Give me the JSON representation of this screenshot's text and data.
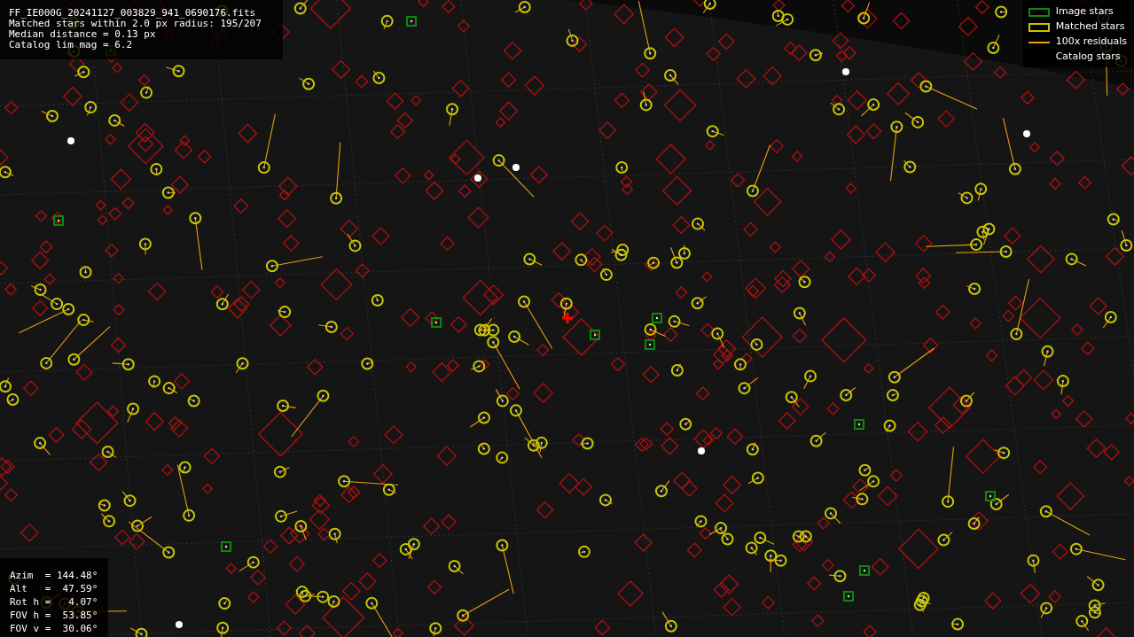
{
  "info_panel": {
    "lines": [
      "FF_IE000G_20241127_003829_941_0690176.fits",
      "Matched stars within 2.0 px radius: 195/207",
      "Median distance = 0.13 px",
      "Catalog lim mag = 6.2"
    ]
  },
  "legend": [
    {
      "kind": "image",
      "label": "Image stars"
    },
    {
      "kind": "matched",
      "label": "Matched stars"
    },
    {
      "kind": "residual",
      "label": "100x residuals"
    },
    {
      "kind": "catalog",
      "label": "Catalog stars"
    }
  ],
  "pointing_panel": {
    "lines": [
      "Azim  = 144.48°",
      "Alt   =  47.59°",
      "Rot h =   4.07°",
      "FOV h =  53.85°",
      "FOV v =  30.06°"
    ]
  }
}
